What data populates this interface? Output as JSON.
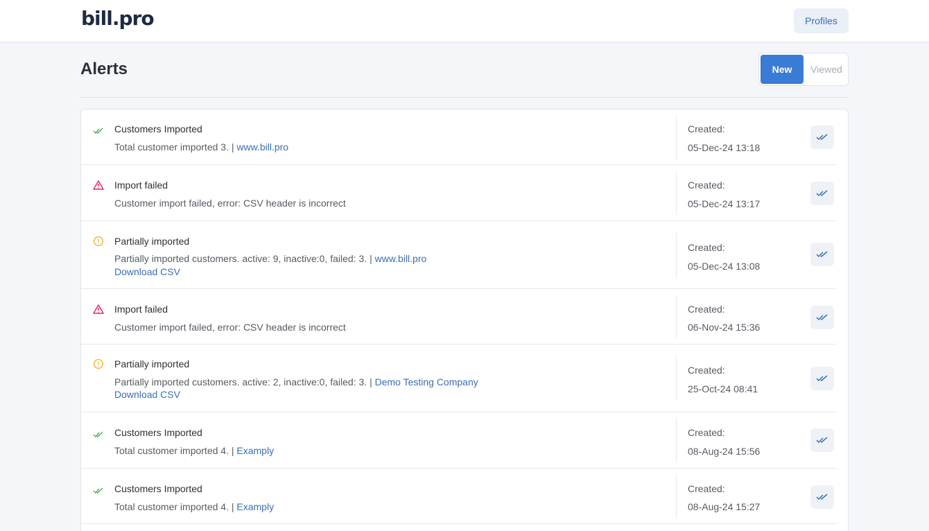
{
  "header": {
    "logo": "bill.pro",
    "profiles_label": "Profiles"
  },
  "page": {
    "title": "Alerts",
    "toggle_new": "New",
    "toggle_viewed": "Viewed"
  },
  "colors": {
    "accent": "#3a7bd5",
    "success": "#4caf50",
    "error": "#e0245e",
    "warning": "#f2b32b",
    "link": "#3a6db5"
  },
  "alerts": [
    {
      "icon": "double-check-icon",
      "status": "success",
      "title": "Customers Imported",
      "message": "Total customer imported 3.",
      "separator": "|",
      "link": "www.bill.pro",
      "download": "",
      "created_label": "Created:",
      "created": "05-Dec-24 13:18"
    },
    {
      "icon": "warning-triangle-icon",
      "status": "error",
      "title": "Import failed",
      "message": "Customer import failed, error: CSV header is incorrect",
      "separator": "",
      "link": "",
      "download": "",
      "created_label": "Created:",
      "created": "05-Dec-24 13:17"
    },
    {
      "icon": "exclamation-circle-icon",
      "status": "warning",
      "title": "Partially imported",
      "message": "Partially imported customers. active: 9, inactive:0, failed: 3.",
      "separator": "|",
      "link": "www.bill.pro",
      "download": "Download CSV",
      "created_label": "Created:",
      "created": "05-Dec-24 13:08"
    },
    {
      "icon": "warning-triangle-icon",
      "status": "error",
      "title": "Import failed",
      "message": "Customer import failed, error: CSV header is incorrect",
      "separator": "",
      "link": "",
      "download": "",
      "created_label": "Created:",
      "created": "06-Nov-24 15:36"
    },
    {
      "icon": "exclamation-circle-icon",
      "status": "warning",
      "title": "Partially imported",
      "message": "Partially imported customers. active: 2, inactive:0, failed: 3.",
      "separator": "|",
      "link": "Demo Testing Company",
      "download": "Download CSV",
      "created_label": "Created:",
      "created": "25-Oct-24 08:41"
    },
    {
      "icon": "double-check-icon",
      "status": "success",
      "title": "Customers Imported",
      "message": "Total customer imported 4.",
      "separator": "|",
      "link": "Examply",
      "download": "",
      "created_label": "Created:",
      "created": "08-Aug-24 15:56"
    },
    {
      "icon": "double-check-icon",
      "status": "success",
      "title": "Customers Imported",
      "message": "Total customer imported 4.",
      "separator": "|",
      "link": "Examply",
      "download": "",
      "created_label": "Created:",
      "created": "08-Aug-24 15:27"
    }
  ]
}
